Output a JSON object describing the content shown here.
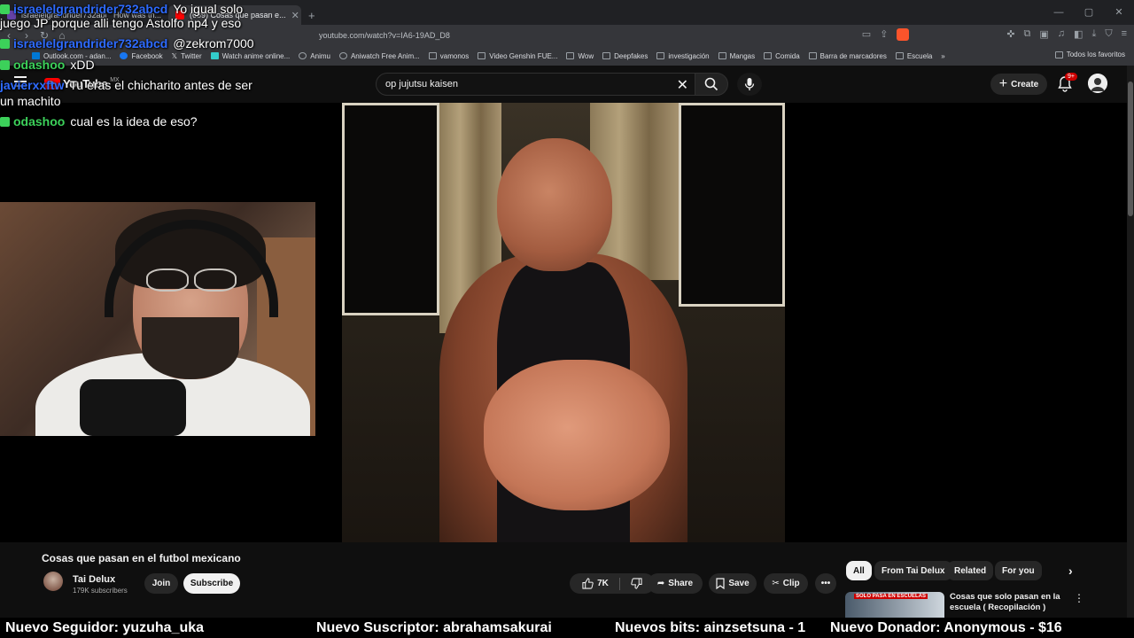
{
  "browser": {
    "tabs": [
      {
        "label": "israelelgrandrider732abcd"
      },
      {
        "label": "How was th..."
      },
      {
        "label": "(689) Cosas que pasan e..."
      }
    ],
    "url": "youtube.com/watch?v=IA6-19AD_D8",
    "bookmarks": [
      {
        "label": "Outlook.com - adan...",
        "icon": "outlook-icon"
      },
      {
        "label": "Facebook",
        "icon": "facebook-icon"
      },
      {
        "label": "Twitter",
        "icon": "twitter-icon"
      },
      {
        "label": "Watch anime online...",
        "icon": "site-icon"
      },
      {
        "label": "Animu",
        "icon": "site-icon"
      },
      {
        "label": "Aniwatch Free Anim...",
        "icon": "site-icon"
      },
      {
        "label": "vamonos",
        "icon": "folder-icon"
      },
      {
        "label": "Video Genshin FUE...",
        "icon": "folder-icon"
      },
      {
        "label": "Wow",
        "icon": "folder-icon"
      },
      {
        "label": "Deepfakes",
        "icon": "folder-icon"
      },
      {
        "label": "investigación",
        "icon": "folder-icon"
      },
      {
        "label": "Mangas",
        "icon": "folder-icon"
      },
      {
        "label": "Comida",
        "icon": "folder-icon"
      },
      {
        "label": "Barra de marcadores",
        "icon": "folder-icon"
      },
      {
        "label": "Escuela",
        "icon": "folder-icon"
      }
    ],
    "bookmarks_all": "Todos los favoritos"
  },
  "youtube": {
    "logo_text": "YouTube",
    "region": "MX",
    "search_value": "op jujutsu kaisen",
    "create_label": "Create",
    "notification_count": "9+"
  },
  "video": {
    "title": "Cosas que pasan en el futbol mexicano",
    "channel": "Tai Delux",
    "subscribers": "179K subscribers",
    "join_label": "Join",
    "subscribe_label": "Subscribe",
    "likes": "7K",
    "share_label": "Share",
    "save_label": "Save",
    "clip_label": "Clip"
  },
  "sidebar": {
    "chips": [
      "All",
      "From Tai Delux",
      "Related",
      "For you"
    ],
    "recommendation": {
      "thumb_text": "SOLO PASA EN ESCUELAS",
      "title": "Cosas que solo pasan en la escuela ( Recopilación )"
    }
  },
  "chat": [
    {
      "user": "israelelgrandrider732abcd",
      "message": "Yo igual solo",
      "color": "#2e6bff"
    },
    {
      "user": "",
      "message": "juego JP porque alli tengo Astolfo np4 y eso",
      "color": "#ffffff"
    },
    {
      "user": "israelelgrandrider732abcd",
      "message": "@zekrom7000",
      "color": "#2e6bff"
    },
    {
      "user": "odashoo",
      "message": "xDD",
      "color": "#3cd15a"
    },
    {
      "user": "javierxxftw",
      "message": "Tu eras el chicharito antes de ser",
      "color": "#2e6bff"
    },
    {
      "user": "",
      "message": "un machito",
      "color": "#ffffff"
    },
    {
      "user": "odashoo",
      "message": "cual es la idea de eso?",
      "color": "#3cd15a"
    }
  ],
  "alerts": [
    "Nuevo Seguidor: yuzuha_uka",
    "Nuevo Suscriptor: abrahamsakurai",
    "Nuevos bits: ainzsetsuna - 1",
    "Nuevo Donador: Anonymous - $16"
  ]
}
